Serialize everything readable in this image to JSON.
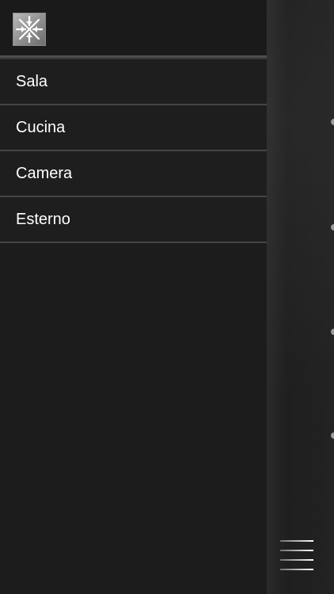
{
  "drawer": {
    "logo_icon": "snowflake-arrows-icon",
    "items": [
      {
        "label": "Sala"
      },
      {
        "label": "Cucina"
      },
      {
        "label": "Camera"
      },
      {
        "label": "Esterno"
      }
    ]
  },
  "toggle_icon": "hamburger-menu-icon",
  "colors": {
    "background": "#1c1c1c",
    "divider": "#454545",
    "text": "#ffffff"
  }
}
